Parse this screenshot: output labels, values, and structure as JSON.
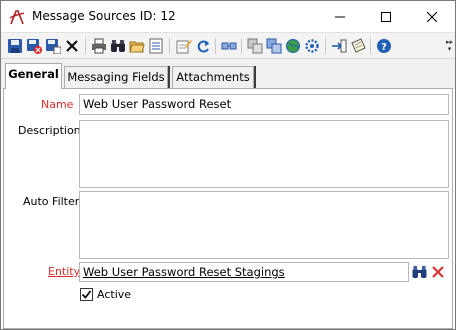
{
  "window": {
    "title": "Message Sources ID: 12"
  },
  "toolbar": {
    "icons": [
      "save-icon",
      "save-close-icon",
      "save-new-icon",
      "delete-icon",
      "print-icon",
      "find-icon",
      "open-folder-icon",
      "list-icon",
      "edit-note-icon",
      "refresh-icon",
      "link-icon",
      "copy-icon",
      "paste-icon",
      "web-icon",
      "settings-icon",
      "export-icon",
      "attach-icon",
      "help-icon"
    ]
  },
  "tabs": [
    {
      "label": "General",
      "active": true
    },
    {
      "label": "Messaging Fields",
      "active": false
    },
    {
      "label": "Attachments",
      "active": false
    }
  ],
  "form": {
    "name_label": "Name",
    "name_value": "Web User Password Reset",
    "description_label": "Description",
    "description_value": "",
    "auto_filter_label": "Auto Filter",
    "auto_filter_value": "",
    "entity_label": "Entity",
    "entity_value": "Web User Password Reset Stagings",
    "active_label": "Active",
    "active_checked": true
  },
  "colors": {
    "required_label": "#d8302d",
    "accent_blue": "#1e5fb4"
  }
}
